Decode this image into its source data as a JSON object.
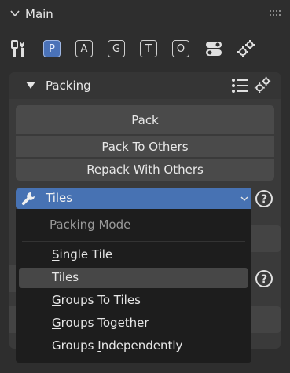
{
  "header": {
    "title": "Main"
  },
  "tabs": [
    {
      "icon": "tools-icon"
    },
    {
      "label": "P",
      "active": true
    },
    {
      "label": "A"
    },
    {
      "label": "G"
    },
    {
      "label": "T"
    },
    {
      "label": "O"
    },
    {
      "icon": "toggle-icon"
    },
    {
      "icon": "gears-icon"
    }
  ],
  "packing": {
    "title": "Packing",
    "buttons": {
      "pack": "Pack",
      "pack_to_others": "Pack To Others",
      "repack": "Repack With Others"
    },
    "mode_dropdown": {
      "selected": "Tiles"
    }
  },
  "menu": {
    "title": "Packing Mode",
    "items": [
      {
        "pre": "",
        "u": "S",
        "post": "ingle Tile"
      },
      {
        "pre": "",
        "u": "T",
        "post": "iles",
        "hovered": true
      },
      {
        "pre": "",
        "u": "G",
        "post": "roups To Tiles"
      },
      {
        "pre": "",
        "u": "G",
        "post": "roups Together"
      },
      {
        "pre": "Groups ",
        "u": "I",
        "post": "ndependently"
      }
    ]
  },
  "colors": {
    "accent": "#4772b3",
    "menu_bg": "#1d1d1d",
    "hover": "#474747"
  }
}
